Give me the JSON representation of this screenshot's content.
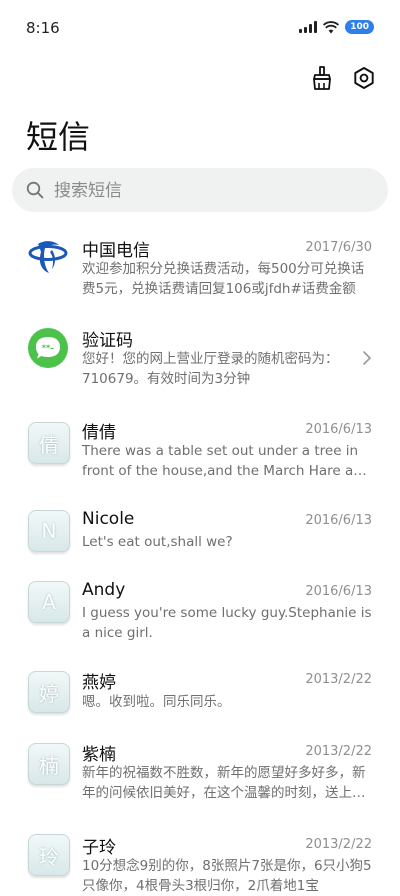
{
  "status_bar": {
    "time": "8:16",
    "battery": "100"
  },
  "page": {
    "title": "短信"
  },
  "search": {
    "placeholder": "搜索短信"
  },
  "messages": [
    {
      "sender": "中国电信",
      "date": "2017/6/30",
      "preview": "欢迎参加积分兑换话费活动，每500分可兑换话费5元，兑换话费请回复106或jfdh#话费金额"
    },
    {
      "sender": "验证码",
      "date": "",
      "preview": "您好！您的网上营业厅登录的随机密码为：710679。有效时间为3分钟"
    },
    {
      "sender": "倩倩",
      "date": "2016/6/13",
      "avatar": "倩",
      "preview": "There was a table set out under a tree in front of the house,and the March Hare and the Hatter were having tea"
    },
    {
      "sender": "Nicole",
      "date": "2016/6/13",
      "avatar": "N",
      "preview": "Let's eat out,shall we?"
    },
    {
      "sender": "Andy",
      "date": "2016/6/13",
      "avatar": "A",
      "preview": "I guess you're some lucky guy.Stephanie is a nice girl."
    },
    {
      "sender": "燕婷",
      "date": "2013/2/22",
      "avatar": "婷",
      "preview": "嗯。收到啦。同乐同乐。"
    },
    {
      "sender": "紫楠",
      "date": "2013/2/22",
      "avatar": "楠",
      "preview": "新年的祝福数不胜数，新年的愿望好多好多，新年的问候依旧美好，在这个温馨的时刻，送上我的祝福"
    },
    {
      "sender": "子玲",
      "date": "2013/2/22",
      "avatar": "玲",
      "preview": "10分想念9别的你，8张照片7张是你，6只小狗5只像你，4根骨头3根归你，2爪着地1宝"
    }
  ],
  "icons": {
    "clean": "broom-icon",
    "settings": "gear-icon",
    "search": "search-icon",
    "telecom": "china-telecom-logo",
    "verification": "message-bubble-icon",
    "chevron": "chevron-right-icon"
  },
  "colors": {
    "battery": "#2f7fe8",
    "telecom_blue": "#1b58b8",
    "verification_green": "#4cc24a",
    "search_bg": "#f0f1f1"
  }
}
